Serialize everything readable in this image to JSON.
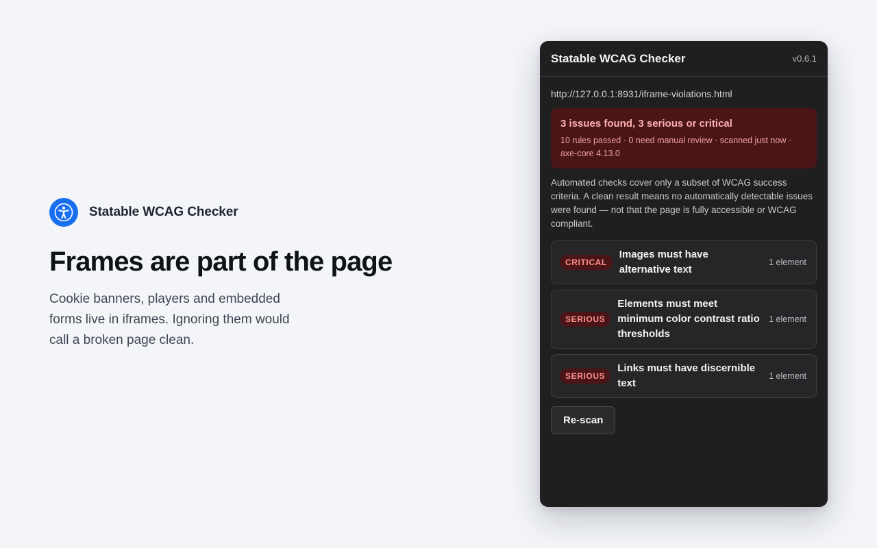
{
  "hero": {
    "brand_name": "Statable WCAG Checker",
    "logo_icon": "accessibility-person-icon",
    "title": "Frames are part of the page",
    "body": "Cookie banners, players and embedded forms live in iframes. Ignoring them would call a broken page clean."
  },
  "panel": {
    "title": "Statable WCAG Checker",
    "version": "v0.6.1",
    "url": "http://127.0.0.1:8931/iframe-violations.html",
    "summary": {
      "headline": "3 issues found, 3 serious or critical",
      "meta": "10 rules passed · 0 need manual review · scanned just now · axe-core 4.13.0"
    },
    "disclaimer": "Automated checks cover only a subset of WCAG success criteria. A clean result means no automatically detectable issues were found — not that the page is fully accessible or WCAG compliant.",
    "issues": [
      {
        "severity": "CRITICAL",
        "title": "Images must have alternative text",
        "count": "1 element"
      },
      {
        "severity": "SERIOUS",
        "title": "Elements must meet minimum color contrast ratio thresholds",
        "count": "1 element"
      },
      {
        "severity": "SERIOUS",
        "title": "Links must have discernible text",
        "count": "1 element"
      }
    ],
    "rescan_label": "Re-scan"
  },
  "colors": {
    "accent": "#1a6ff0",
    "panel_bg": "#1f1f20",
    "summary_bg": "#4a1517",
    "severity_text": "#ff8f8f"
  }
}
